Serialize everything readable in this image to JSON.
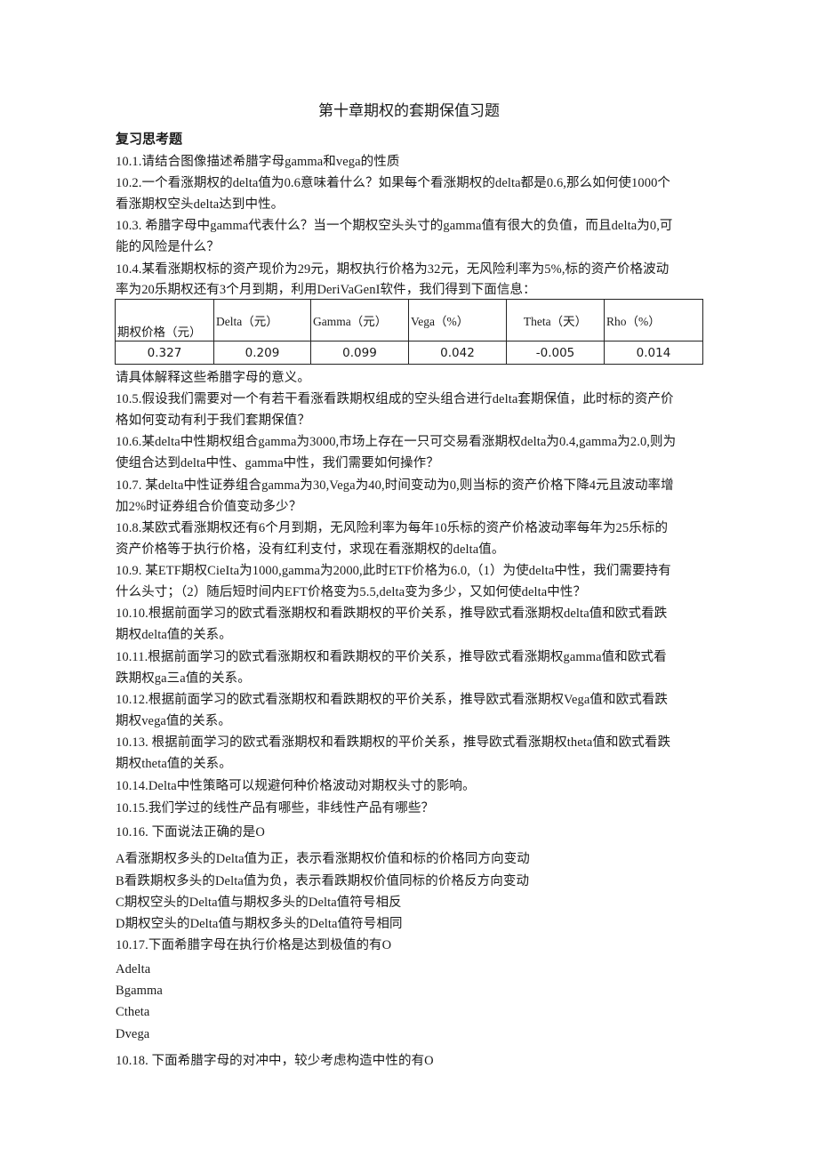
{
  "document": {
    "title": "第十章期权的套期保值习题",
    "section_heading": "复习思考题",
    "lines_before_table": [
      "10.1.请结合图像描述希腊字母gamma和vega的性质",
      "10.2.一个看涨期权的delta值为0.6意味着什么？如果每个看涨期权的delta都是0.6,那么如何使1000个",
      "看涨期权空头delta达到中性。",
      "10.3. 希腊字母中gamma代表什么？当一个期权空头头寸的gamma值有很大的负值，而且delta为0,可",
      "能的风险是什么？",
      "10.4.某看涨期权标的资产现价为29元，期权执行价格为32元，无风险利率为5%,标的资产价格波动",
      "率为20乐期权还有3个月到期，利用DeriVaGenI软件，我们得到下面信息："
    ],
    "greeks_table": {
      "headers": [
        "期权价格（元）",
        "Delta（元）",
        "Gamma（元）",
        "Vega（%）",
        "Theta（天）",
        "Rho（%）"
      ],
      "values": [
        "0.327",
        "0.209",
        "0.099",
        "0.042",
        "-0.005",
        "0.014"
      ]
    },
    "lines_after_table": [
      "请具体解释这些希腊字母的意义。",
      "10.5.假设我们需要对一个有若干看涨看跌期权组成的空头组合进行delta套期保值，此时标的资产价",
      "格如何变动有利于我们套期保值？",
      "10.6.某delta中性期权组合gamma为3000,市场上存在一只可交易看涨期权delta为0.4,gamma为2.0,则为",
      "使组合达到delta中性、gamma中性，我们需要如何操作？",
      "10.7. 某delta中性证券组合gamma为30,Vega为40,时间变动为0,则当标的资产价格下降4元且波动率增",
      "加2%时证券组合价值变动多少？",
      "10.8.某欧式看涨期权还有6个月到期，无风险利率为每年10乐标的资产价格波动率每年为25乐标的",
      "资产价格等于执行价格，没有红利支付，求现在看涨期权的delta值。",
      "10.9. 某ETF期权CieIta为1000,gamma为2000,此时ETF价格为6.0,（1）为使delta中性，我们需要持有",
      "什么头寸；（2）随后短时间内EFT价格变为5.5,delta变为多少，又如何使delta中性？",
      "10.10.根据前面学习的欧式看涨期权和看跌期权的平价关系，推导欧式看涨期权delta值和欧式看跌",
      "期权delta值的关系。",
      "10.11.根据前面学习的欧式看涨期权和看跌期权的平价关系，推导欧式看涨期权gamma值和欧式看",
      "跌期权ga三a值的关系。",
      "10.12.根据前面学习的欧式看涨期权和看跌期权的平价关系，推导欧式看涨期权Vega值和欧式看跌",
      "期权vega值的关系。",
      "10.13. 根据前面学习的欧式看涨期权和看跌期权的平价关系，推导欧式看涨期权theta值和欧式看跌",
      "期权theta值的关系。",
      "10.14.Delta中性策略可以规避何种价格波动对期权头寸的影响。",
      "10.15.我们学过的线性产品有哪些，非线性产品有哪些？",
      "10.16. 下面说法正确的是O",
      "A看涨期权多头的Delta值为正，表示看涨期权价值和标的价格同方向变动",
      "B看跌期权多头的Delta值为负，表示看跌期权价值同标的价格反方向变动",
      "C期权空头的Delta值与期权多头的Delta值符号相反",
      "D期权空头的Delta值与期权多头的Delta值符号相同",
      "10.17.下面希腊字母在执行价格是达到极值的有O",
      "Adelta",
      "Bgamma",
      "Ctheta",
      "Dvega",
      "10.18. 下面希腊字母的对冲中，较少考虑构造中性的有O"
    ]
  }
}
